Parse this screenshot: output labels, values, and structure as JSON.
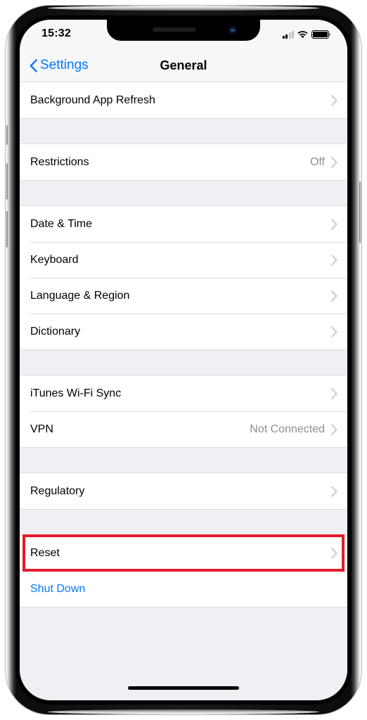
{
  "status_bar": {
    "time": "15:32",
    "signal_icon": "cellular-signal-icon",
    "signal_bars_total": 4,
    "signal_bars_active": 2,
    "wifi_icon": "wifi-icon",
    "battery_icon": "battery-icon",
    "battery_level_percent": 100
  },
  "nav_bar": {
    "back_label": "Settings",
    "back_icon": "chevron-left-icon",
    "title": "General"
  },
  "colors": {
    "accent_blue": "#007AFF",
    "highlight_red": "#E8192C",
    "value_gray": "#8E8E93",
    "chevron_gray": "#C7C7CC",
    "group_background": "#FFFFFF",
    "page_background": "#EFEFF4"
  },
  "annotation": {
    "highlighted_row": "Reset",
    "box_color": "#E8192C"
  },
  "groups": [
    {
      "rows": [
        {
          "label": "Background App Refresh",
          "value": "",
          "accessory": "chevron-right-icon",
          "style": "default"
        }
      ]
    },
    {
      "rows": [
        {
          "label": "Restrictions",
          "value": "Off",
          "accessory": "chevron-right-icon",
          "style": "default"
        }
      ]
    },
    {
      "rows": [
        {
          "label": "Date & Time",
          "value": "",
          "accessory": "chevron-right-icon",
          "style": "default"
        },
        {
          "label": "Keyboard",
          "value": "",
          "accessory": "chevron-right-icon",
          "style": "default"
        },
        {
          "label": "Language & Region",
          "value": "",
          "accessory": "chevron-right-icon",
          "style": "default"
        },
        {
          "label": "Dictionary",
          "value": "",
          "accessory": "chevron-right-icon",
          "style": "default"
        }
      ]
    },
    {
      "rows": [
        {
          "label": "iTunes Wi-Fi Sync",
          "value": "",
          "accessory": "chevron-right-icon",
          "style": "default"
        },
        {
          "label": "VPN",
          "value": "Not Connected",
          "accessory": "chevron-right-icon",
          "style": "default"
        }
      ]
    },
    {
      "rows": [
        {
          "label": "Regulatory",
          "value": "",
          "accessory": "chevron-right-icon",
          "style": "default"
        }
      ]
    },
    {
      "rows": [
        {
          "label": "Reset",
          "value": "",
          "accessory": "chevron-right-icon",
          "style": "default",
          "highlighted": true
        },
        {
          "label": "Shut Down",
          "value": "",
          "accessory": "none",
          "style": "link"
        }
      ]
    }
  ],
  "home_indicator": "home-indicator",
  "hardware_buttons": [
    {
      "name": "mute-switch",
      "side": "left"
    },
    {
      "name": "volume-up-button",
      "side": "left"
    },
    {
      "name": "volume-down-button",
      "side": "left"
    },
    {
      "name": "power-button",
      "side": "right"
    }
  ]
}
